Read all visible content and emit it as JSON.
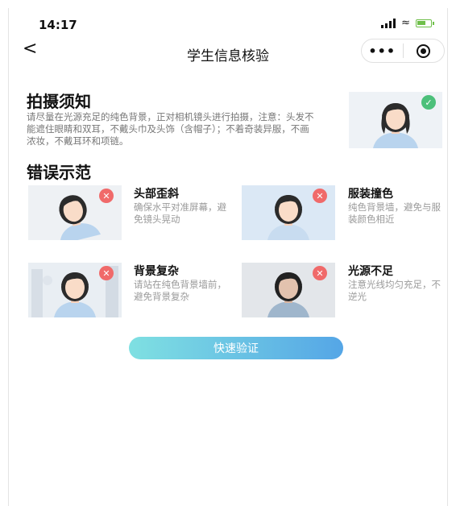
{
  "status": {
    "time": "14:17"
  },
  "nav": {
    "title": "学生信息核验",
    "back_icon": "chevron-left-icon",
    "more_label": "•••"
  },
  "notice": {
    "title": "拍摄须知",
    "text": "请尽量在光源充足的纯色背景，正对相机镜头进行拍摄，注意：头发不能遮住眼睛和双耳，不戴头巾及头饰（含帽子）；不着奇装异服，不画浓妆，不戴耳环和项链。"
  },
  "errors": {
    "title": "错误示范",
    "items": [
      {
        "title": "头部歪斜",
        "desc": "确保水平对准屏幕，避免镜头晃动"
      },
      {
        "title": "服装撞色",
        "desc": "纯色背景墙，避免与服装颜色相近"
      },
      {
        "title": "背景复杂",
        "desc": "请站在纯色背景墙前，避免背景复杂"
      },
      {
        "title": "光源不足",
        "desc": "注意光线均匀充足，不逆光"
      }
    ]
  },
  "actions": {
    "verify_label": "快速验证"
  },
  "colors": {
    "accent_start": "#7fe0e2",
    "accent_end": "#55a6e6",
    "ok": "#4cc07a",
    "error": "#f06a6a"
  }
}
